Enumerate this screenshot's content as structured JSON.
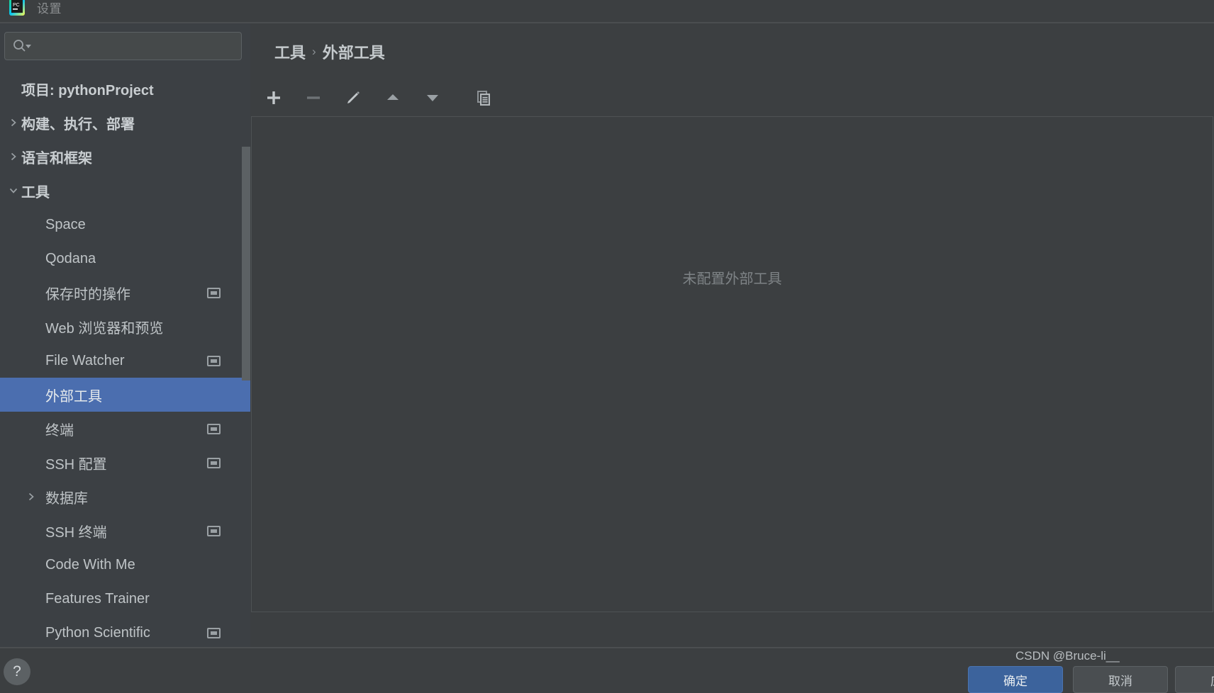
{
  "window": {
    "title": "设置",
    "app_icon": "pycharm-icon"
  },
  "search": {
    "value": "",
    "placeholder": "",
    "icon": "search-icon",
    "dropdown_icon": "caret-down-icon"
  },
  "sidebar": {
    "project_label": "项目: pythonProject",
    "items": [
      {
        "label": "构建、执行、部署",
        "level": 0,
        "twisty": "chevron-right-icon",
        "badge": false,
        "selected": false
      },
      {
        "label": "语言和框架",
        "level": 0,
        "twisty": "chevron-right-icon",
        "badge": false,
        "selected": false
      },
      {
        "label": "工具",
        "level": 0,
        "twisty": "chevron-down-icon",
        "badge": false,
        "selected": false
      },
      {
        "label": "Space",
        "level": 1,
        "twisty": "",
        "badge": false,
        "selected": false
      },
      {
        "label": "Qodana",
        "level": 1,
        "twisty": "",
        "badge": false,
        "selected": false
      },
      {
        "label": "保存时的操作",
        "level": 1,
        "twisty": "",
        "badge": true,
        "selected": false
      },
      {
        "label": "Web 浏览器和预览",
        "level": 1,
        "twisty": "",
        "badge": false,
        "selected": false
      },
      {
        "label": "File Watcher",
        "level": 1,
        "twisty": "",
        "badge": true,
        "selected": false
      },
      {
        "label": "外部工具",
        "level": 1,
        "twisty": "",
        "badge": false,
        "selected": true
      },
      {
        "label": "终端",
        "level": 1,
        "twisty": "",
        "badge": true,
        "selected": false
      },
      {
        "label": "SSH 配置",
        "level": 1,
        "twisty": "",
        "badge": true,
        "selected": false
      },
      {
        "label": "数据库",
        "level": 1,
        "twisty": "chevron-right-icon",
        "badge": false,
        "selected": false
      },
      {
        "label": "SSH 终端",
        "level": 1,
        "twisty": "",
        "badge": true,
        "selected": false
      },
      {
        "label": "Code With Me",
        "level": 1,
        "twisty": "",
        "badge": false,
        "selected": false
      },
      {
        "label": "Features Trainer",
        "level": 1,
        "twisty": "",
        "badge": false,
        "selected": false
      },
      {
        "label": "Python Scientific",
        "level": 1,
        "twisty": "",
        "badge": true,
        "selected": false
      }
    ]
  },
  "main": {
    "breadcrumb": {
      "parent": "工具",
      "separator": "›",
      "current": "外部工具"
    },
    "toolbar": [
      {
        "name": "add-button",
        "icon": "plus-icon",
        "enabled": true
      },
      {
        "name": "remove-button",
        "icon": "minus-icon",
        "enabled": false
      },
      {
        "name": "edit-button",
        "icon": "pencil-icon",
        "enabled": true
      },
      {
        "name": "move-up-button",
        "icon": "triangle-up-icon",
        "enabled": true
      },
      {
        "name": "move-down-button",
        "icon": "triangle-down-icon",
        "enabled": true
      },
      {
        "name": "copy-button",
        "icon": "copy-icon",
        "enabled": true
      }
    ],
    "empty_message": "未配置外部工具"
  },
  "bottom": {
    "help_icon": "question-mark-icon",
    "ok_label": "确定",
    "cancel_label": "取消",
    "apply_label": "应用"
  },
  "watermark": "CSDN @Bruce-li__",
  "colors": {
    "window_bg": "#3c3f41",
    "sidebar_bg": "#3c4044",
    "selection_blue": "#4b6eaf",
    "primary_button": "#3c639c",
    "text": "#bfc4c7",
    "muted_text": "#7e8386"
  }
}
